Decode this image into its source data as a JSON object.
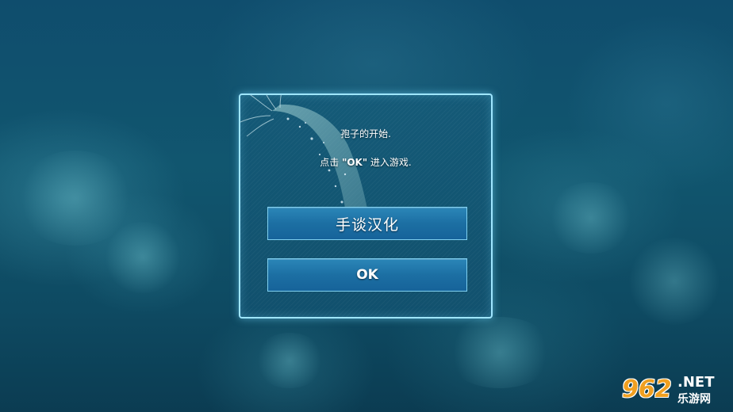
{
  "dialog": {
    "line1": "孢子的开始.",
    "line2_prefix": "点击 ",
    "line2_ok": "\"OK\"",
    "line2_suffix": " 进入游戏.",
    "lang_button_label": "手谈汉化",
    "ok_button_label": "OK"
  },
  "watermark": {
    "number": "962",
    "net": ".NET",
    "site_name": "乐游网"
  },
  "colors": {
    "dialog_border": "#9fe6ff",
    "button_fill": "#1c6fa3",
    "watermark_orange": "#f0a020"
  }
}
